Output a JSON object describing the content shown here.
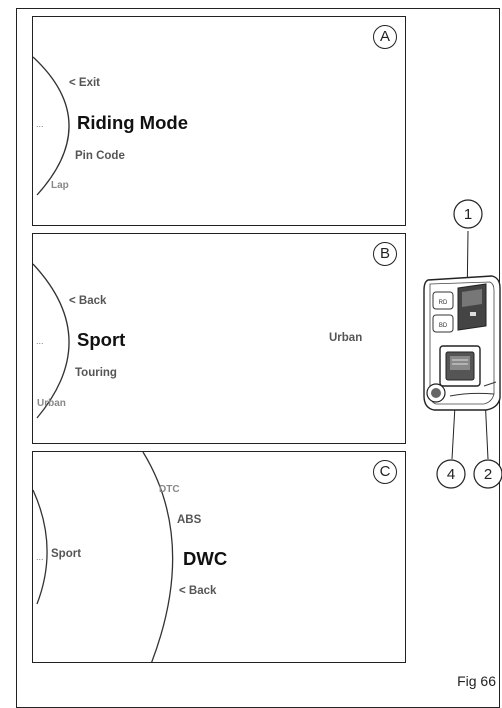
{
  "panels": {
    "a": {
      "letter": "A",
      "items": {
        "prev": "< Exit",
        "selected": "Riding Mode",
        "next": "Pin Code",
        "faded": "Lap",
        "dots": "..."
      }
    },
    "b": {
      "letter": "B",
      "items": {
        "prev": "< Back",
        "selected": "Sport",
        "next": "Touring",
        "faded": "Urban",
        "right": "Urban",
        "dots": "..."
      }
    },
    "c": {
      "letter": "C",
      "items": {
        "faded": "DTC",
        "prev": "ABS",
        "selected": "DWC",
        "next": "< Back",
        "left": "Sport",
        "dots": "..."
      }
    }
  },
  "callouts": [
    "1",
    "2",
    "4"
  ],
  "device_labels": {
    "top_left": "RD",
    "bottom_left": "BD"
  },
  "figure_label": "Fig 66"
}
